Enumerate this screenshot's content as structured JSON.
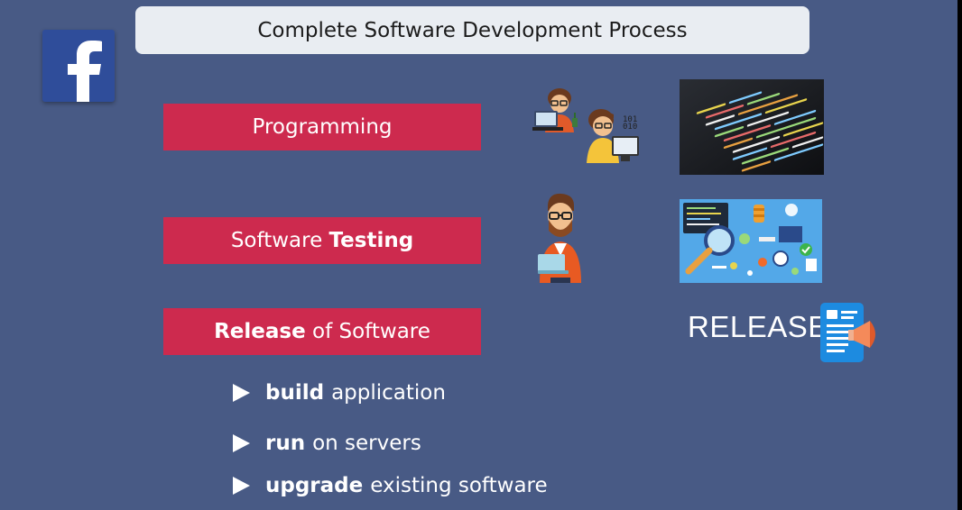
{
  "title": "Complete Software Development Process",
  "steps": [
    {
      "bold": "",
      "text": "Programming",
      "bold_first": false
    },
    {
      "pre": "Software ",
      "bold": "Testing"
    },
    {
      "bold": "Release",
      "post": " of Software"
    }
  ],
  "release_label": "RELEASE",
  "bullets": [
    {
      "bold": "build",
      "text": "application"
    },
    {
      "bold": "run",
      "text": "on servers"
    },
    {
      "bold": "upgrade",
      "text": "existing software"
    }
  ],
  "colors": {
    "background": "#485a85",
    "title_bar": "#e9edf2",
    "step_box": "#cd2a4e",
    "facebook": "#2f4d9a"
  },
  "icons": [
    "facebook-logo-icon",
    "programmers-illustration-icon",
    "code-screen-image",
    "tester-illustration-icon",
    "testing-dashboard-image",
    "release-document-megaphone-icon",
    "bullet-arrow-icon"
  ]
}
